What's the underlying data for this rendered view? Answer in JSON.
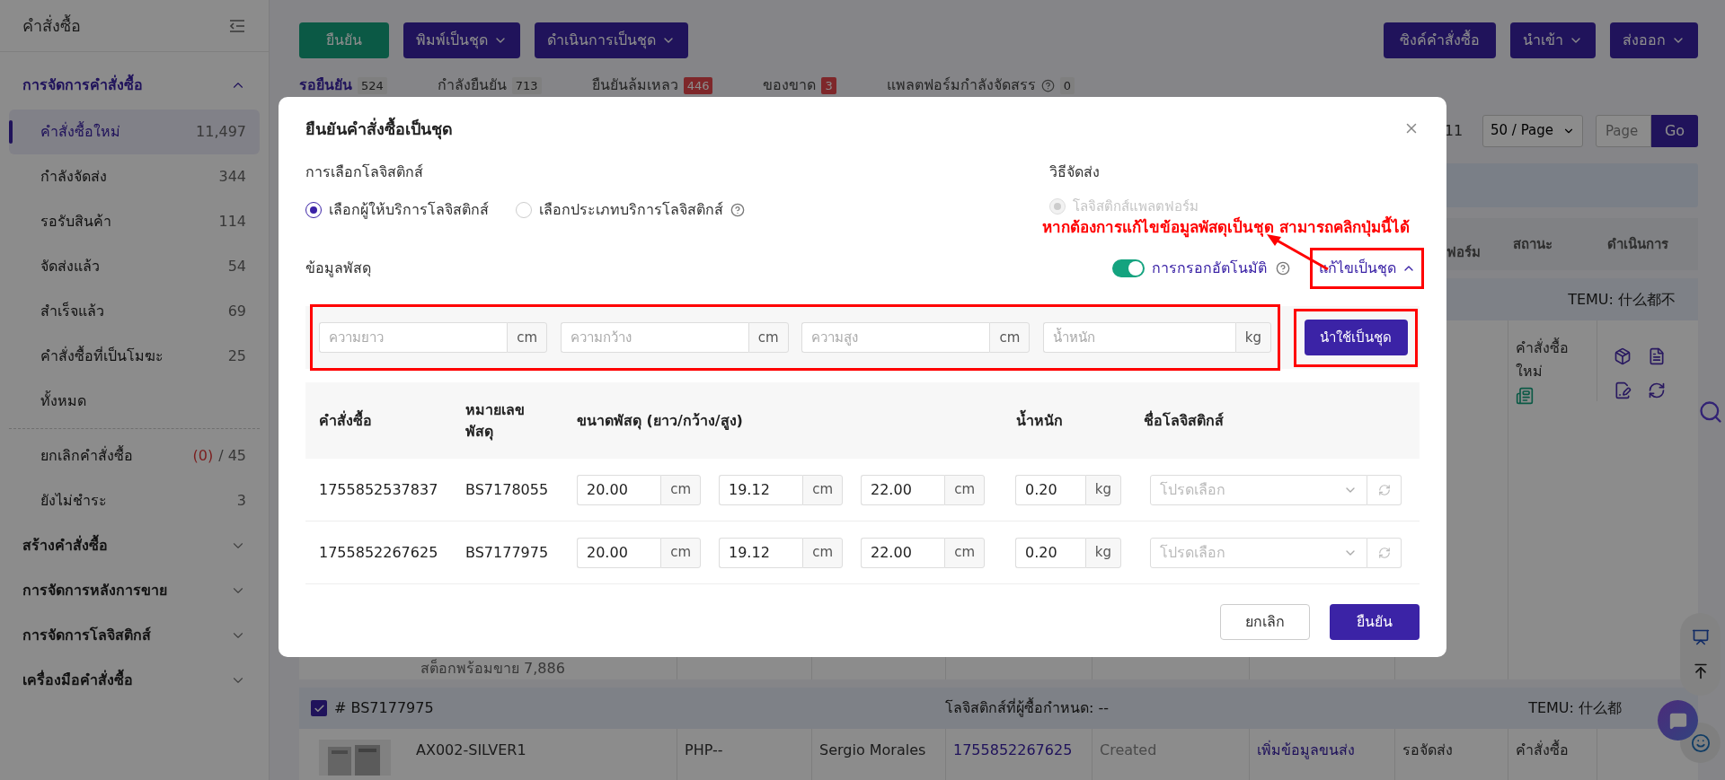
{
  "sidebar": {
    "title": "คำสั่งซื้อ",
    "sections": [
      {
        "label": "การจัดการคำสั่งซื้อ",
        "expanded": true,
        "items": [
          {
            "label": "คำสั่งซื้อใหม่",
            "count": "11,497",
            "selected": true
          },
          {
            "label": "กำลังจัดส่ง",
            "count": "344",
            "selected": false
          },
          {
            "label": "รอรับสินค้า",
            "count": "114",
            "selected": false
          },
          {
            "label": "จัดส่งแล้ว",
            "count": "54",
            "selected": false
          },
          {
            "label": "สำเร็จแล้ว",
            "count": "69",
            "selected": false
          },
          {
            "label": "คำสั่งซื้อที่เป็นโมฆะ",
            "count": "25",
            "selected": false
          },
          {
            "label": "ทั้งหมด",
            "selected": false
          }
        ],
        "extra_items": [
          {
            "label": "ยกเลิกคำสั่งซื้อ",
            "alert_count": "(0)",
            "count": "/ 45",
            "selected": false
          },
          {
            "label": "ยังไม่ชำระ",
            "count": "3",
            "selected": false
          }
        ]
      },
      {
        "label": "สร้างคำสั่งซื้อ",
        "expanded": false
      },
      {
        "label": "การจัดการหลังการขาย",
        "expanded": false
      },
      {
        "label": "การจัดการโลจิสติกส์",
        "expanded": false
      },
      {
        "label": "เครื่องมือคำสั่งซื้อ",
        "expanded": false
      }
    ]
  },
  "toolbar": {
    "left_buttons": [
      {
        "label": "ยืนยัน",
        "kind": "primary"
      },
      {
        "label": "พิมพ์เป็นชุด",
        "kind": "dropdown"
      },
      {
        "label": "ดำเนินการเป็นชุด",
        "kind": "dropdown"
      }
    ],
    "right_buttons": [
      {
        "label": "ซิงค์คำสั่งซื้อ",
        "kind": "plain"
      },
      {
        "label": "นำเข้า",
        "kind": "dropdown"
      },
      {
        "label": "ส่งออก",
        "kind": "dropdown"
      }
    ]
  },
  "status_tabs": [
    {
      "label": "รอยืนยัน",
      "count": "524",
      "alert": false,
      "help": false,
      "selected": true
    },
    {
      "label": "กำลังยืนยัน",
      "count": "713",
      "alert": false,
      "help": false,
      "selected": false
    },
    {
      "label": "ยืนยันล้มเหลว",
      "count": "446",
      "alert": true,
      "help": false,
      "selected": false
    },
    {
      "label": "ของขาด",
      "count": "3",
      "alert": true,
      "help": false,
      "selected": false
    },
    {
      "label": "แพลตฟอร์มกำลังจัดสรร",
      "count": "0",
      "alert": false,
      "help": true,
      "selected": false
    }
  ],
  "pagination": {
    "last_page": "11",
    "page_size": "50 / Page",
    "page_placeholder": "Page",
    "go": "Go"
  },
  "orders_table": {
    "columns": [
      "ฟอร์ม",
      "สถานะ",
      "ดำเนินการ"
    ],
    "groups": [
      {
        "shop": "TEMU: 什么都不",
        "row": {
          "status": "คำสั่งซื้อใหม่",
          "stock": "สต็อกพร้อมขาย 7,886"
        }
      },
      {
        "checked": true,
        "parcel": "# BS7177975",
        "buyer_logistics": "โลจิสติกส์ที่ผู้ซื้อกำหนด: --",
        "shop": "TEMU: 什么都",
        "row": {
          "sku": "AX002-SILVER1",
          "price": "PHP--",
          "buyer": "Sergio Morales",
          "order_no": "1755852267625",
          "platform_status": "Created",
          "logistics_link": "เพิ่มข้อมูลขนส่ง",
          "shipping": "รอจัดส่ง",
          "status": "คำสั่งซื้อ"
        }
      }
    ]
  },
  "dialog": {
    "title": "ยืนยันคำสั่งซื้อเป็นชุด",
    "logistics_choice": {
      "label": "การเลือกโลจิสติกส์",
      "options": [
        {
          "label": "เลือกผู้ให้บริการโลจิสติกส์",
          "selected": true,
          "help": false
        },
        {
          "label": "เลือกประเภทบริการโลจิสติกส์",
          "selected": false,
          "help": true
        }
      ]
    },
    "shipping_method": {
      "label": "วิธีจัดส่ง",
      "options": [
        {
          "label": "โลจิสติกส์แพลตฟอร์ม",
          "selected": true,
          "disabled": true
        }
      ]
    },
    "parcel": {
      "label": "ข้อมูลพัสดุ",
      "autofill": {
        "label": "การกรอกอัตโนมัติ",
        "on": true
      },
      "batch_edit": {
        "label": "แก้ไขเป็นชุด",
        "expanded": true
      },
      "batch_fields": [
        {
          "placeholder": "ความยาว",
          "unit": "cm"
        },
        {
          "placeholder": "ความกว้าง",
          "unit": "cm"
        },
        {
          "placeholder": "ความสูง",
          "unit": "cm"
        },
        {
          "placeholder": "น้ำหนัก",
          "unit": "kg"
        }
      ],
      "apply_button": "นำใช้เป็นชุด"
    },
    "table": {
      "columns": [
        "คำสั่งซื้อ",
        "หมายเลขพัสดุ",
        "ขนาดพัสดุ (ยาว/กว้าง/สูง)",
        "น้ำหนัก",
        "ชื่อโลจิสติกส์"
      ],
      "rows": [
        {
          "order": "1755852537837",
          "parcel_no": "BS7178055",
          "dims": [
            {
              "value": "20.00",
              "unit": "cm"
            },
            {
              "value": "19.12",
              "unit": "cm"
            },
            {
              "value": "22.00",
              "unit": "cm"
            }
          ],
          "weight": {
            "value": "0.20",
            "unit": "kg"
          },
          "logistics": {
            "placeholder": "โปรดเลือก"
          }
        },
        {
          "order": "1755852267625",
          "parcel_no": "BS7177975",
          "dims": [
            {
              "value": "20.00",
              "unit": "cm"
            },
            {
              "value": "19.12",
              "unit": "cm"
            },
            {
              "value": "22.00",
              "unit": "cm"
            }
          ],
          "weight": {
            "value": "0.20",
            "unit": "kg"
          },
          "logistics": {
            "placeholder": "โปรดเลือก"
          }
        }
      ]
    },
    "buttons": [
      {
        "label": "ยกเลิก",
        "kind": "secondary"
      },
      {
        "label": "ยืนยัน",
        "kind": "primary"
      }
    ],
    "annotation": "หากต้องการแก้ไขข้อมูลพัสดุเป็นชุด สามารถคลิกปุ่มนี้ได้"
  }
}
